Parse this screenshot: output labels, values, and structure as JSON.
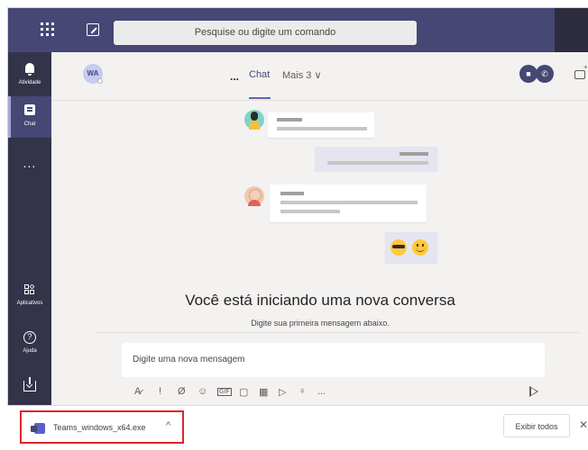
{
  "topbar": {
    "search_placeholder": "Pesquise ou digite um comando"
  },
  "rail": {
    "items": [
      {
        "label": "Atividade",
        "icon": "bell-icon"
      },
      {
        "label": "Chat",
        "icon": "chat-icon"
      },
      {
        "label": "...",
        "icon": "more-icon"
      },
      {
        "label": "Aplicativos",
        "icon": "apps-icon"
      },
      {
        "label": "Ajuda",
        "icon": "help-icon"
      },
      {
        "label": "",
        "icon": "download-icon"
      }
    ]
  },
  "header": {
    "avatar_initials": "WA",
    "more": "...",
    "tab_chat": "Chat",
    "tab_more": "Mais 3 ∨"
  },
  "conversation": {
    "title": "Você está iniciando uma nova conversa",
    "subtitle": "Digite sua primeira mensagem abaixo."
  },
  "composer": {
    "placeholder": "Digite uma nova mensagem",
    "toolbar": [
      "A̷",
      "!",
      "Ø",
      "☺",
      "GIF",
      "▢",
      "▦",
      "▷",
      "♀",
      "..."
    ]
  },
  "download_bar": {
    "file_name": "Teams_windows_x64.exe",
    "chevron": "^",
    "show_all": "Exibir todos",
    "close": "✕"
  },
  "colors": {
    "brand": "#464775",
    "rail": "#33344a",
    "accent": "#6264a7",
    "highlight_border": "#e0242c"
  }
}
